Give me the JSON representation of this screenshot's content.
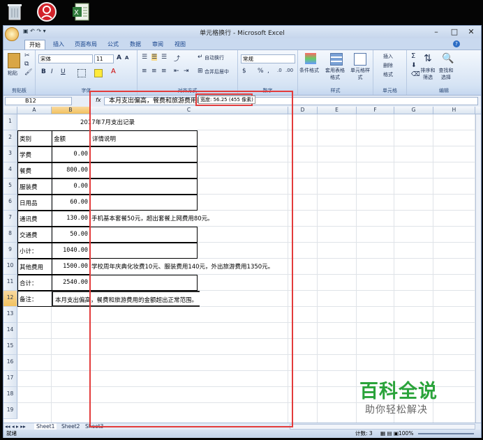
{
  "window": {
    "title": "单元格换行 - Microsoft Excel"
  },
  "tabs": [
    "开始",
    "插入",
    "页面布局",
    "公式",
    "数据",
    "审阅",
    "视图"
  ],
  "ribbon": {
    "clipboard": {
      "paste": "粘贴",
      "label": "剪贴板"
    },
    "font": {
      "name": "宋体",
      "size": "11",
      "label": "字体",
      "bold": "B",
      "italic": "I",
      "underline": "U",
      "font_color": "A",
      "grow": "A",
      "shrink": "A"
    },
    "alignment": {
      "wrap": "自动换行",
      "merge": "合并后居中",
      "label": "对齐方式"
    },
    "number": {
      "format": "常规",
      "percent": "%",
      "comma": ",",
      "label": "数字"
    },
    "styles": {
      "conditional": "条件格式",
      "table": "套用表格格式",
      "cell": "单元格样式",
      "label": "样式"
    },
    "cells": {
      "insert": "插入",
      "delete": "删除",
      "format": "格式",
      "label": "单元格"
    },
    "editing": {
      "sum": "Σ",
      "sort": "排序和筛选",
      "find": "查找和选择",
      "label": "编辑"
    }
  },
  "formula_bar": {
    "name_box": "B12",
    "fx": "fx",
    "content": "本月支出偏高，餐费和旅游费用的金额超出正常范围。"
  },
  "tooltip": "宽度: 56.25 (455 像素)",
  "columns": [
    "A",
    "B",
    "C",
    "D",
    "E",
    "F",
    "G",
    "H"
  ],
  "rows": [
    "1",
    "2",
    "3",
    "4",
    "5",
    "6",
    "7",
    "8",
    "9",
    "10",
    "11",
    "12",
    "13",
    "14",
    "15",
    "16",
    "17",
    "18",
    "19"
  ],
  "cells": {
    "title": "2017年7月支出记录",
    "header": [
      "类别",
      "金额",
      "详情说明"
    ],
    "data": [
      [
        "学费",
        "0.00",
        ""
      ],
      [
        "餐费",
        "800.00",
        ""
      ],
      [
        "服装费",
        "0.00",
        ""
      ],
      [
        "日用品",
        "60.00",
        ""
      ],
      [
        "通讯费",
        "130.00",
        "手机基本套餐50元，超出套餐上网费用80元。"
      ],
      [
        "交通费",
        "50.00",
        ""
      ],
      [
        "小计：",
        "1040.00",
        ""
      ],
      [
        "其他费用",
        "1500.00",
        "学校周年庆典化妆费10元、服装费用140元，外出旅游费用1350元。"
      ],
      [
        "合计：",
        "2540.00",
        ""
      ],
      [
        "备注：",
        "本月支出偏高，餐费和旅游费用的金额超出正常范围。",
        ""
      ]
    ]
  },
  "sheet_tabs": [
    "Sheet1",
    "Sheet2",
    "Sheet3"
  ],
  "status": {
    "ready": "就绪",
    "count": "计数: 3",
    "zoom": "100%"
  },
  "watermark": {
    "main": "百科全说",
    "sub": "助你轻松解决"
  },
  "colors": {
    "accent": "#e33b3b",
    "watermark": "#2aa33a"
  }
}
